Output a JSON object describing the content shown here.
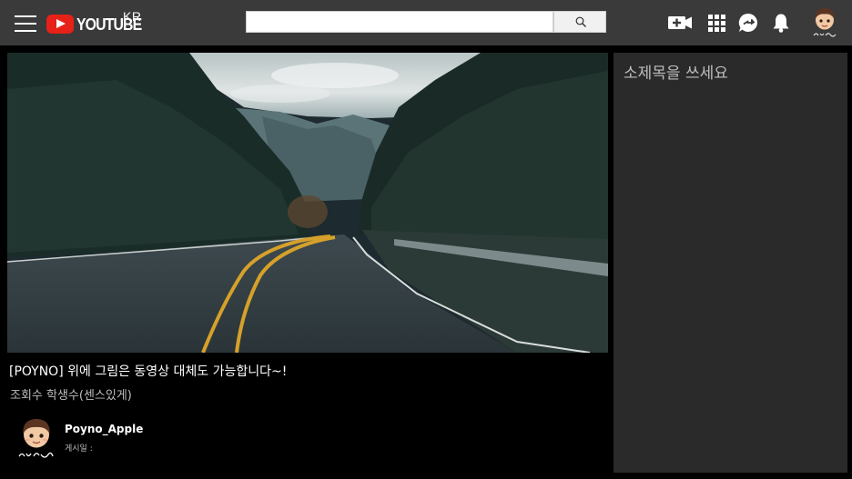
{
  "header": {
    "logo_text": "YOUTUBE",
    "logo_region": "KR",
    "search": {
      "value": "",
      "placeholder": ""
    },
    "icons": [
      "menu-icon",
      "youtube-logo-icon",
      "search-icon",
      "video-camera-add-icon",
      "apps-grid-icon",
      "messages-icon",
      "notifications-bell-icon",
      "avatar"
    ]
  },
  "video": {
    "title": "[POYNO] 위에 그림은 동영상 대체도 가능합니다~!",
    "views": "조회수 학생수(센스있게)",
    "channel_name": "Poyno_Apple",
    "date_label": "게시일 :"
  },
  "sidebar": {
    "title": "소제목을 쓰세요"
  },
  "colors": {
    "topbar": "#3a3a3a",
    "background": "#000000",
    "sidebar": "#2a2a2a",
    "logo_red": "#e62117"
  }
}
